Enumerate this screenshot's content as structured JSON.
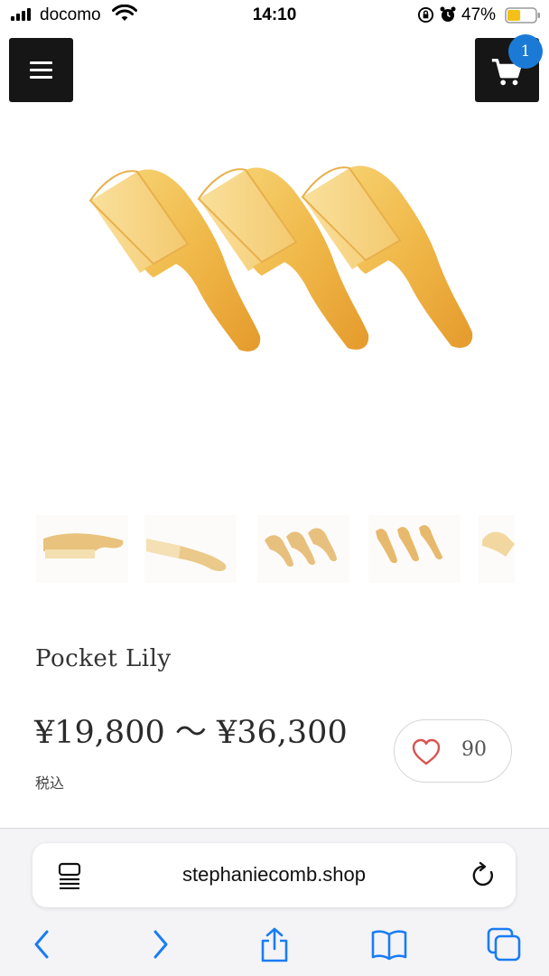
{
  "status_bar": {
    "carrier": "docomo",
    "time": "14:10",
    "battery_percent": "47%",
    "battery_level": 0.47,
    "battery_color": "#f2c018"
  },
  "header": {
    "menu_icon": "hamburger-icon",
    "cart_icon": "cart-icon",
    "cart_count": "1",
    "badge_color": "#1b7ad6"
  },
  "product": {
    "title": "Pocket Lily",
    "price": "¥19,800 〜 ¥36,300",
    "tax_note": "税込",
    "like_count": "90",
    "heart_color": "#d9534f"
  },
  "browser": {
    "url": "stephaniecomb.shop",
    "icons": [
      "reader-icon",
      "reload-icon",
      "back-icon",
      "forward-icon",
      "share-icon",
      "bookmarks-icon",
      "tabs-icon"
    ],
    "accent": "#1a7cf5"
  }
}
